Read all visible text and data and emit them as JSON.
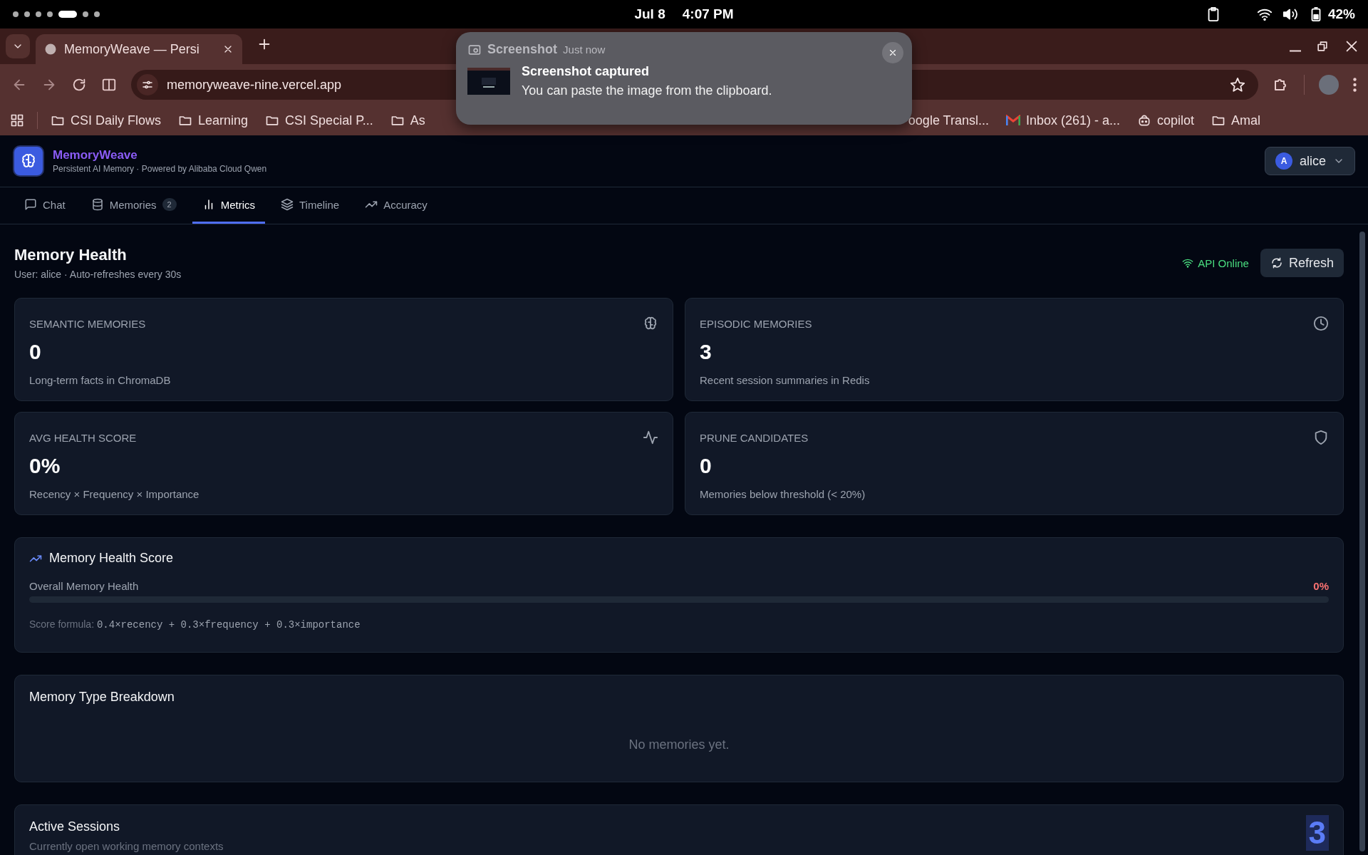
{
  "status_bar": {
    "date": "Jul 8",
    "time": "4:07 PM",
    "battery": "42%"
  },
  "browser": {
    "tab_title": "MemoryWeave — Persi",
    "url": "memoryweave-nine.vercel.app",
    "bookmarks": [
      {
        "label": "CSI Daily Flows",
        "kind": "folder"
      },
      {
        "label": "Learning",
        "kind": "folder"
      },
      {
        "label": "CSI Special P...",
        "kind": "folder"
      },
      {
        "label": "As",
        "kind": "folder"
      },
      {
        "label": "oogle Transl...",
        "kind": "plain"
      },
      {
        "label": "Inbox (261) - a...",
        "kind": "mail"
      },
      {
        "label": "copilot",
        "kind": "bot"
      },
      {
        "label": "Amal",
        "kind": "folder"
      }
    ]
  },
  "notification": {
    "app": "Screenshot",
    "time": "Just now",
    "title": "Screenshot captured",
    "body": "You can paste the image from the clipboard."
  },
  "app": {
    "name": "MemoryWeave",
    "subtitle": "Persistent AI Memory · Powered by Alibaba Cloud Qwen",
    "user": {
      "initial": "A",
      "name": "alice"
    },
    "tabs": [
      {
        "label": "Chat",
        "selected": false
      },
      {
        "label": "Memories",
        "badge": "2",
        "selected": false
      },
      {
        "label": "Metrics",
        "selected": true
      },
      {
        "label": "Timeline",
        "selected": false
      },
      {
        "label": "Accuracy",
        "selected": false
      }
    ]
  },
  "metrics": {
    "title": "Memory Health",
    "subtitle": "User: alice · Auto-refreshes every 30s",
    "status": "API Online",
    "refresh": "Refresh",
    "stats": [
      {
        "label": "SEMANTIC MEMORIES",
        "value": "0",
        "description": "Long-term facts in ChromaDB"
      },
      {
        "label": "EPISODIC MEMORIES",
        "value": "3",
        "description": "Recent session summaries in Redis"
      },
      {
        "label": "AVG HEALTH SCORE",
        "value": "0%",
        "description": "Recency × Frequency × Importance"
      },
      {
        "label": "PRUNE CANDIDATES",
        "value": "0",
        "description": "Memories below threshold (< 20%)"
      }
    ],
    "health": {
      "title": "Memory Health Score",
      "label": "Overall Memory Health",
      "reading": "0%",
      "level": 0,
      "formula_label": "Score formula:",
      "formula": "0.4×recency + 0.3×frequency + 0.3×importance"
    },
    "breakdown": {
      "title": "Memory Type Breakdown",
      "empty": "No memories yet."
    },
    "sessions": {
      "title": "Active Sessions",
      "subtitle": "Currently open working memory contexts",
      "count": "3"
    }
  }
}
